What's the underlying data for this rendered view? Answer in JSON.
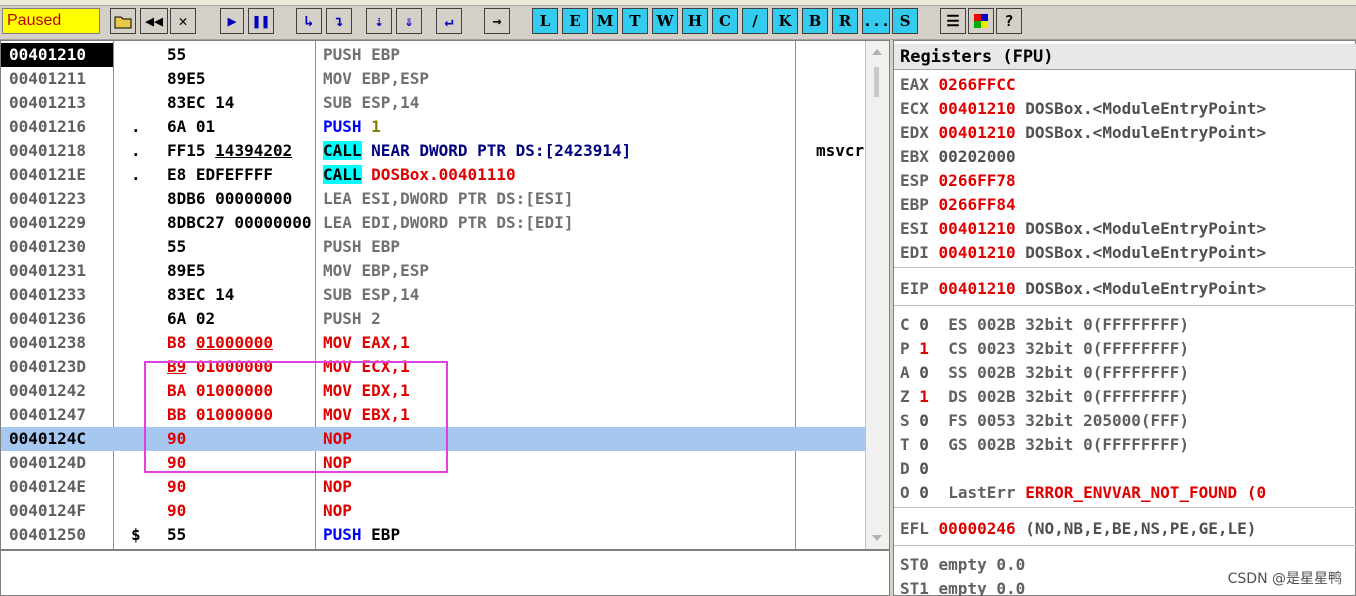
{
  "toolbar": {
    "status": "Paused",
    "letters": [
      "L",
      "E",
      "M",
      "T",
      "W",
      "H",
      "C",
      "/",
      "K",
      "B",
      "R",
      "...",
      "S"
    ],
    "help": "?"
  },
  "disassembly": {
    "rows": [
      {
        "addr": "00401210",
        "mark": "",
        "hex": "55",
        "asm": "PUSH EBP",
        "cmt": ""
      },
      {
        "addr": "00401211",
        "mark": "",
        "hex": "89E5",
        "asm": "MOV EBP,ESP",
        "cmt": ""
      },
      {
        "addr": "00401213",
        "mark": "",
        "hex": "83EC 14",
        "asm": "SUB ESP,14",
        "cmt": ""
      },
      {
        "addr": "00401216",
        "mark": ".",
        "hex": "6A 01",
        "asm_op": "PUSH",
        "asm_arg": "1",
        "cmt": ""
      },
      {
        "addr": "00401218",
        "mark": ".",
        "hex_a": "FF15",
        "hex_b": "14394202",
        "asm_op": "CALL",
        "asm_arg": "NEAR DWORD PTR DS:[2423914]",
        "cmt": "msvcr"
      },
      {
        "addr": "0040121E",
        "mark": ".",
        "hex": "E8 EDFEFFFF",
        "asm_op": "CALL",
        "asm_arg": "DOSBox.00401110",
        "cmt": ""
      },
      {
        "addr": "00401223",
        "mark": "",
        "hex": "8DB6 00000000",
        "asm": "LEA ESI,DWORD PTR DS:[ESI]",
        "cmt": ""
      },
      {
        "addr": "00401229",
        "mark": "",
        "hex": "8DBC27 00000000",
        "asm": "LEA EDI,DWORD PTR DS:[EDI]",
        "cmt": ""
      },
      {
        "addr": "00401230",
        "mark": "",
        "hex": "55",
        "asm": "PUSH EBP",
        "cmt": ""
      },
      {
        "addr": "00401231",
        "mark": "",
        "hex": "89E5",
        "asm": "MOV EBP,ESP",
        "cmt": ""
      },
      {
        "addr": "00401233",
        "mark": "",
        "hex": "83EC 14",
        "asm": "SUB ESP,14",
        "cmt": ""
      },
      {
        "addr": "00401236",
        "mark": "",
        "hex": "6A 02",
        "asm": "PUSH 2",
        "cmt": ""
      },
      {
        "addr": "00401238",
        "mark": "",
        "hex_a": "B8",
        "hex_b": "01000000",
        "asm": "MOV EAX,1",
        "cmt": ""
      },
      {
        "addr": "0040123D",
        "mark": "",
        "hex_a": "B9",
        "hex_b": "01000000",
        "asm": "MOV ECX,1",
        "cmt": ""
      },
      {
        "addr": "00401242",
        "mark": "",
        "hex_a": "BA",
        "hex_b": "01000000",
        "asm": "MOV EDX,1",
        "cmt": ""
      },
      {
        "addr": "00401247",
        "mark": "",
        "hex_a": "BB",
        "hex_b": "01000000",
        "asm": "MOV EBX,1",
        "cmt": ""
      },
      {
        "addr": "0040124C",
        "mark": "",
        "hex": "90",
        "asm": "NOP",
        "cmt": ""
      },
      {
        "addr": "0040124D",
        "mark": "",
        "hex": "90",
        "asm": "NOP",
        "cmt": ""
      },
      {
        "addr": "0040124E",
        "mark": "",
        "hex": "90",
        "asm": "NOP",
        "cmt": ""
      },
      {
        "addr": "0040124F",
        "mark": "",
        "hex": "90",
        "asm": "NOP",
        "cmt": ""
      },
      {
        "addr": "00401250",
        "mark": "$",
        "hex": "55",
        "asm_op": "PUSH",
        "asm_arg": "EBP",
        "cmt": ""
      }
    ]
  },
  "registers": {
    "title": "Registers (FPU)",
    "gpr": [
      {
        "name": "EAX",
        "val": "0266FFCC",
        "sym": ""
      },
      {
        "name": "ECX",
        "val": "00401210",
        "sym": "DOSBox.<ModuleEntryPoint>"
      },
      {
        "name": "EDX",
        "val": "00401210",
        "sym": "DOSBox.<ModuleEntryPoint>"
      },
      {
        "name": "EBX",
        "val": "00202000",
        "sym": ""
      },
      {
        "name": "ESP",
        "val": "0266FF78",
        "sym": ""
      },
      {
        "name": "EBP",
        "val": "0266FF84",
        "sym": ""
      },
      {
        "name": "ESI",
        "val": "00401210",
        "sym": "DOSBox.<ModuleEntryPoint>"
      },
      {
        "name": "EDI",
        "val": "00401210",
        "sym": "DOSBox.<ModuleEntryPoint>"
      }
    ],
    "eip": {
      "name": "EIP",
      "val": "00401210",
      "sym": "DOSBox.<ModuleEntryPoint>"
    },
    "flags": [
      {
        "f": "C",
        "v": "0",
        "seg": "ES",
        "sel": "002B",
        "bits": "32bit",
        "base": "0(FFFFFFFF)"
      },
      {
        "f": "P",
        "v": "1",
        "seg": "CS",
        "sel": "0023",
        "bits": "32bit",
        "base": "0(FFFFFFFF)"
      },
      {
        "f": "A",
        "v": "0",
        "seg": "SS",
        "sel": "002B",
        "bits": "32bit",
        "base": "0(FFFFFFFF)"
      },
      {
        "f": "Z",
        "v": "1",
        "seg": "DS",
        "sel": "002B",
        "bits": "32bit",
        "base": "0(FFFFFFFF)"
      },
      {
        "f": "S",
        "v": "0",
        "seg": "FS",
        "sel": "0053",
        "bits": "32bit",
        "base": "205000(FFF)"
      },
      {
        "f": "T",
        "v": "0",
        "seg": "GS",
        "sel": "002B",
        "bits": "32bit",
        "base": "0(FFFFFFFF)"
      },
      {
        "f": "D",
        "v": "0"
      },
      {
        "f": "O",
        "v": "0",
        "lasterr_label": "LastErr",
        "lasterr": "ERROR_ENVVAR_NOT_FOUND (0"
      }
    ],
    "efl": {
      "name": "EFL",
      "val": "00000246",
      "desc": "(NO,NB,E,BE,NS,PE,GE,LE)"
    },
    "fpu": [
      "ST0 empty 0.0",
      "ST1 empty 0.0"
    ]
  },
  "watermark": "CSDN @是星星鸭"
}
